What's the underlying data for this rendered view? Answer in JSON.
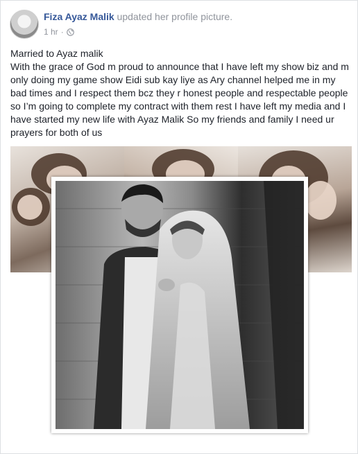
{
  "post": {
    "author": "Fiza Ayaz Malik",
    "action": " updated her profile picture.",
    "time": "1 hr",
    "separator": "·",
    "privacy_icon": "globe-icon",
    "text_line1": "Married to Ayaz malik",
    "text_body": "With the grace of God m proud to announce that I have left my show biz and m only doing my game show Eidi sub kay liye as Ary channel helped me in my bad times and I respect them bcz they r honest people and respectable people so I’m going to complete my contract with them rest I have left my media and I have started my new life with Ayaz Malik So my friends and family I need ur prayers for both of us"
  },
  "colors": {
    "author_link": "#365899",
    "meta_gray": "#90949c",
    "text": "#1d2129",
    "border": "#dddfe2"
  }
}
